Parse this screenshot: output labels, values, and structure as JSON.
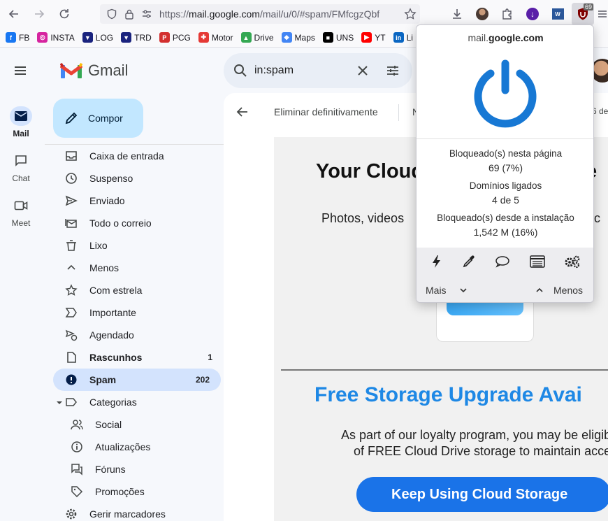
{
  "browser": {
    "url_prefix": "https://",
    "url_domain": "mail.google.com",
    "url_rest": "/mail/u/0/#spam/FMfcgzQbf",
    "ublock_badge": "69"
  },
  "bookmarks": [
    {
      "label": "FB",
      "color": "#1877f2",
      "glyph": "f"
    },
    {
      "label": "INSTA",
      "color": "#d6249f",
      "glyph": "◎"
    },
    {
      "label": "LOG",
      "color": "#1a237e",
      "glyph": "▼"
    },
    {
      "label": "TRD",
      "color": "#1a237e",
      "glyph": "▼"
    },
    {
      "label": "PCG",
      "color": "#d32f2f",
      "glyph": "P"
    },
    {
      "label": "Motor",
      "color": "#e53935",
      "glyph": "✚"
    },
    {
      "label": "Drive",
      "color": "#34a853",
      "glyph": "▲"
    },
    {
      "label": "Maps",
      "color": "#4285f4",
      "glyph": "◆"
    },
    {
      "label": "UNS",
      "color": "#000000",
      "glyph": "■"
    },
    {
      "label": "YT",
      "color": "#ff0000",
      "glyph": "▶"
    },
    {
      "label": "Li",
      "color": "#0a66c2",
      "glyph": "in"
    }
  ],
  "gmail": {
    "app_name": "Gmail",
    "search_query": "in:spam",
    "compose_label": "Compor",
    "rail": [
      {
        "label": "Mail",
        "icon": "mail-icon",
        "active": true
      },
      {
        "label": "Chat",
        "icon": "chat-icon",
        "active": false
      },
      {
        "label": "Meet",
        "icon": "video-icon",
        "active": false
      }
    ],
    "nav": [
      {
        "label": "Caixa de entrada",
        "icon": "inbox-icon",
        "count": ""
      },
      {
        "label": "Suspenso",
        "icon": "clock-icon",
        "count": ""
      },
      {
        "label": "Enviado",
        "icon": "send-icon",
        "count": ""
      },
      {
        "label": "Todo o correio",
        "icon": "all-mail-icon",
        "count": ""
      },
      {
        "label": "Lixo",
        "icon": "trash-icon",
        "count": ""
      },
      {
        "label": "Menos",
        "icon": "chevron-up-icon",
        "count": ""
      },
      {
        "label": "Com estrela",
        "icon": "star-icon",
        "count": ""
      },
      {
        "label": "Importante",
        "icon": "important-icon",
        "count": ""
      },
      {
        "label": "Agendado",
        "icon": "scheduled-icon",
        "count": ""
      },
      {
        "label": "Rascunhos",
        "icon": "draft-icon",
        "count": "1",
        "bold": true
      },
      {
        "label": "Spam",
        "icon": "spam-icon",
        "count": "202",
        "bold": true,
        "active": true
      },
      {
        "label": "Categorias",
        "icon": "label-icon",
        "count": ""
      },
      {
        "label": "Social",
        "icon": "people-icon",
        "count": "",
        "sub": true
      },
      {
        "label": "Atualizações",
        "icon": "info-icon",
        "count": "",
        "sub": true
      },
      {
        "label": "Fóruns",
        "icon": "forum-icon",
        "count": "",
        "sub": true
      },
      {
        "label": "Promoções",
        "icon": "tag-icon",
        "count": "",
        "sub": true
      },
      {
        "label": "Gerir marcadores",
        "icon": "gear-icon",
        "count": ""
      }
    ],
    "toolbar": {
      "delete_forever": "Eliminar definitivamente",
      "not_spam_partial": "N",
      "counter_partial": "6 de"
    }
  },
  "email": {
    "headline": "Your  Cloud",
    "headline_tail": "e",
    "subline": "Photos,  videos",
    "subline_tail": "oc",
    "storage_title": "Free Storage Upgrade Avai",
    "storage_p1": "As part of our loyalty program, you may be eligible to r",
    "storage_p2": "of FREE Cloud Drive storage to maintain access to",
    "cta": "Keep Using Cloud Storage"
  },
  "popup": {
    "domain_prefix": "mail.",
    "domain_bold": "google.com",
    "blocked_page_label": "Bloqueado(s) nesta página",
    "blocked_page_value": "69 (7%)",
    "domains_label": "Domínios ligados",
    "domains_value": "4 de 5",
    "blocked_install_label": "Bloqueado(s) desde a instalação",
    "blocked_install_value": "1,542 M (16%)",
    "more_label": "Mais",
    "less_label": "Menos",
    "power_color": "#1778d4"
  }
}
